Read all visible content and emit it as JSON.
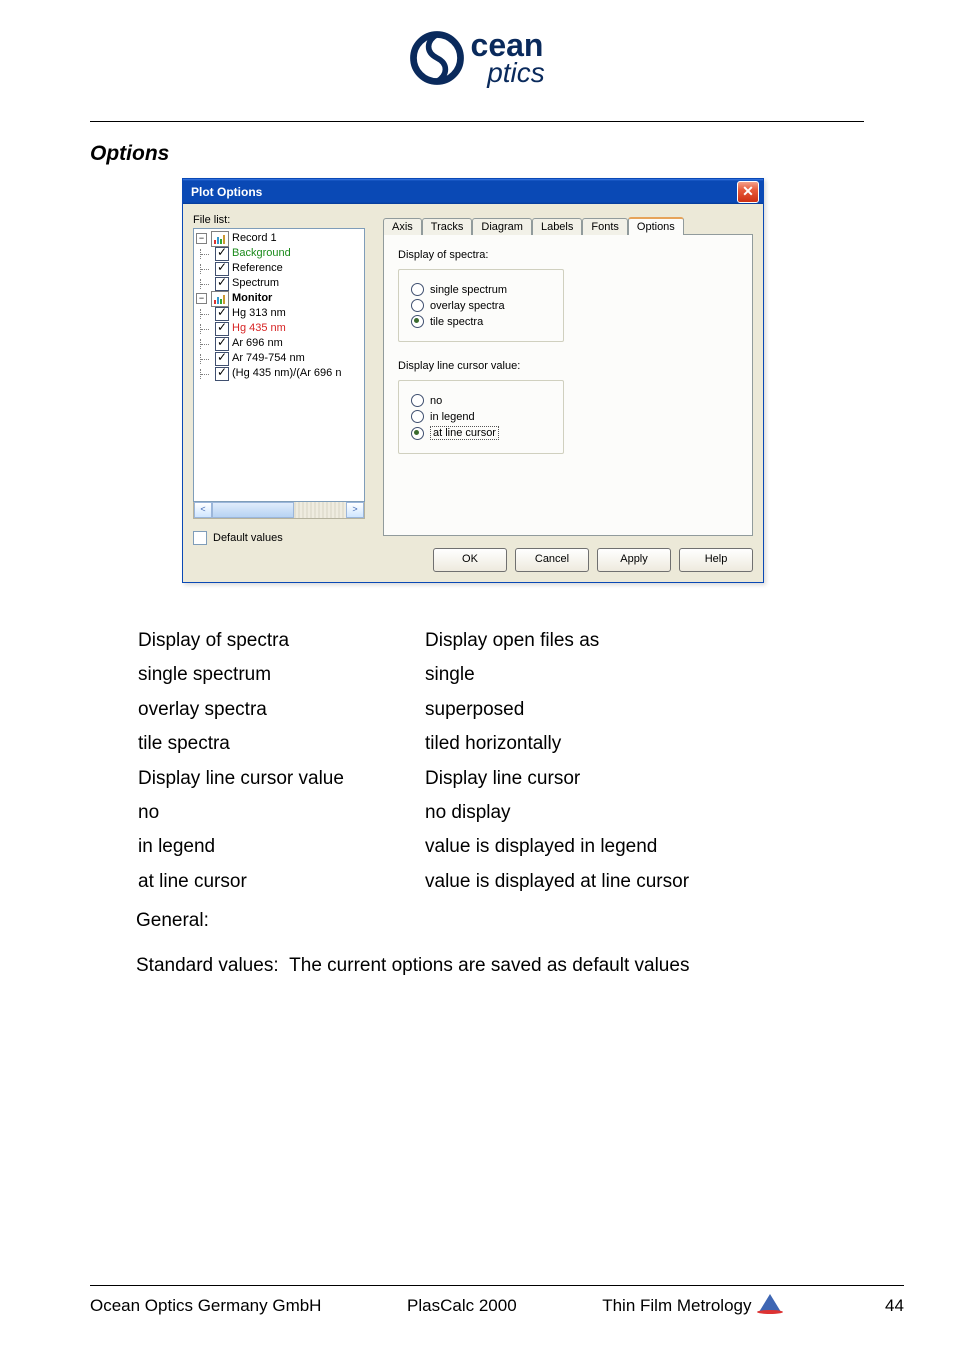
{
  "header": {
    "logo_top": "cean",
    "logo_bottom": "ptics"
  },
  "section_heading": "Options",
  "dialog": {
    "title": "Plot Options",
    "file_list_label": "File list:",
    "tree": {
      "record": {
        "label": "Record 1",
        "expanded": true
      },
      "record_children": [
        {
          "label": "Background",
          "checked": true,
          "style": "green"
        },
        {
          "label": "Reference",
          "checked": true
        },
        {
          "label": "Spectrum",
          "checked": true
        }
      ],
      "monitor": {
        "label": "Monitor",
        "expanded": true,
        "bold": true
      },
      "monitor_children": [
        {
          "label": "Hg 313 nm",
          "checked": true
        },
        {
          "label": "Hg 435 nm",
          "checked": true,
          "style": "red"
        },
        {
          "label": "Ar 696 nm",
          "checked": true
        },
        {
          "label": "Ar 749-754 nm",
          "checked": true
        },
        {
          "label": "(Hg 435 nm)/(Ar 696 n",
          "checked": true
        }
      ]
    },
    "default_values_label": "Default values",
    "tabs": [
      "Axis",
      "Tracks",
      "Diagram",
      "Labels",
      "Fonts",
      "Options"
    ],
    "active_tab": 5,
    "panel": {
      "group1_title": "Display of spectra:",
      "group1_options": [
        {
          "label": "single spectrum",
          "selected": false
        },
        {
          "label": "overlay spectra",
          "selected": false
        },
        {
          "label": "tile spectra",
          "selected": true
        }
      ],
      "group2_title": "Display line cursor value:",
      "group2_options": [
        {
          "label": "no",
          "selected": false
        },
        {
          "label": "in legend",
          "selected": false
        },
        {
          "label": "at line cursor",
          "selected": true
        }
      ]
    },
    "buttons": {
      "ok": "OK",
      "cancel": "Cancel",
      "apply": "Apply",
      "help": "Help"
    }
  },
  "explain": {
    "rows": [
      {
        "l": "Display of spectra",
        "r": "Display open files as",
        "indent": false
      },
      {
        "l": "single spectrum",
        "r": "single",
        "indent": true
      },
      {
        "l": "overlay spectra",
        "r": "superposed",
        "indent": true
      },
      {
        "l": "tile spectra",
        "r": "tiled horizontally",
        "indent": true
      },
      {
        "l": "Display line cursor value",
        "r": "Display line cursor",
        "indent": false
      },
      {
        "l": "no",
        "r": "no display",
        "indent": true
      },
      {
        "l": "in legend",
        "r": "value is displayed in legend",
        "indent": true
      },
      {
        "l": "at line cursor",
        "r": "value is displayed at line cursor",
        "indent": true
      }
    ],
    "general_label": "General:",
    "std_label": "Standard values:",
    "std_text": "The current options are saved as default values"
  },
  "footer": {
    "left": "Ocean Optics Germany GmbH",
    "center": "PlasCalc 2000",
    "right": "Thin Film Metrology",
    "page": "44"
  }
}
